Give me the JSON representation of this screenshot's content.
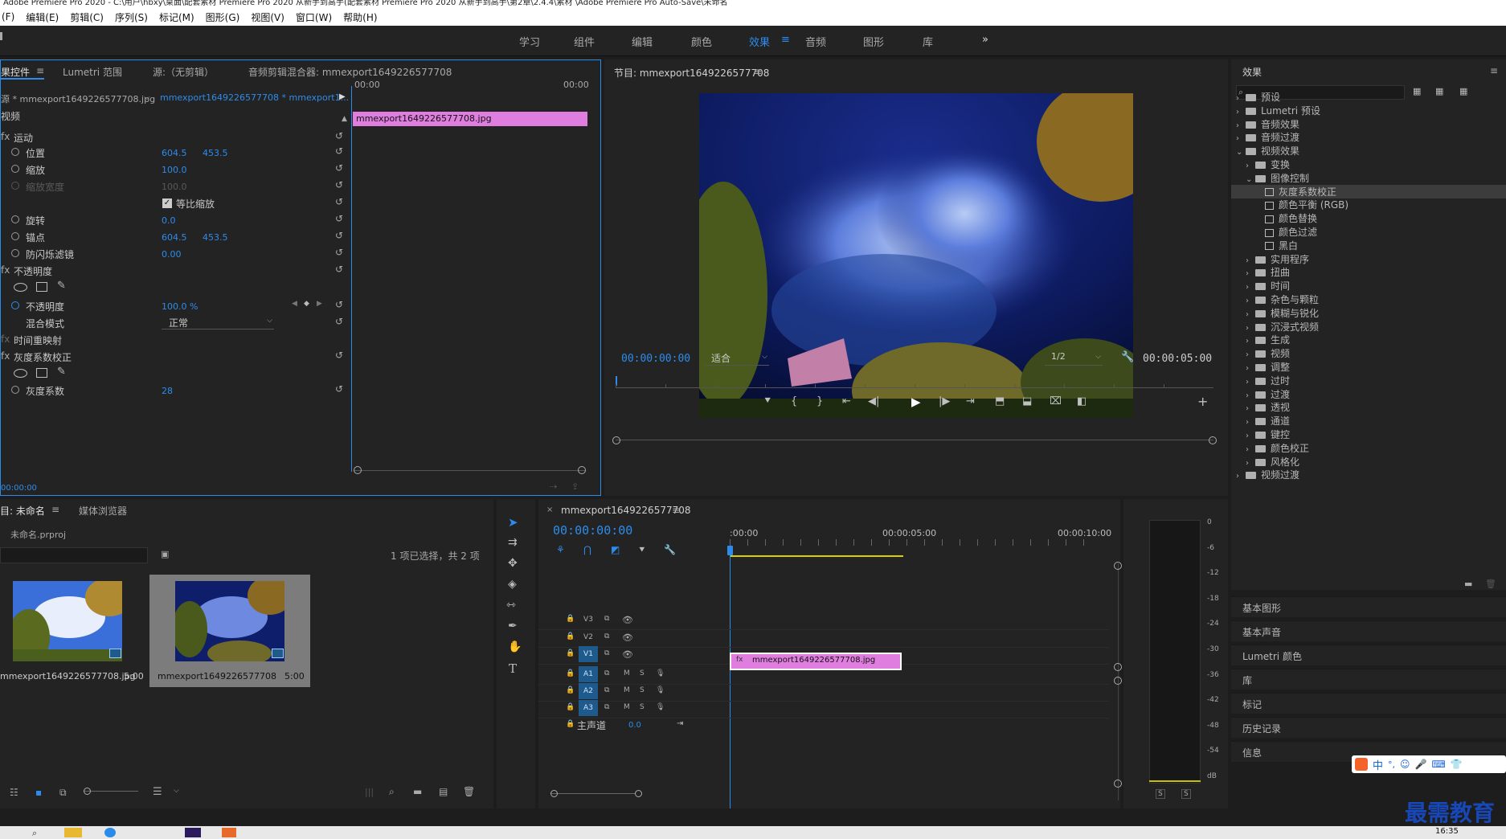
{
  "window": {
    "title": "Adobe Premiere Pro 2020 - C:\\用户\\hbxy\\桌面\\配套素材 Premiere Pro 2020 从新手到高手(配套素材 Premiere Pro 2020 从新手到高手\\第2章\\2.4.4\\素材 \\Adobe Premiere Pro Auto-Save\\未命名"
  },
  "menu": [
    "(F)",
    "编辑(E)",
    "剪辑(C)",
    "序列(S)",
    "标记(M)",
    "图形(G)",
    "视图(V)",
    "窗口(W)",
    "帮助(H)"
  ],
  "workspaces": [
    "学习",
    "组件",
    "编辑",
    "颜色",
    "效果",
    "音频",
    "图形",
    "库",
    "»"
  ],
  "active_workspace": "效果",
  "effect_controls": {
    "tabs": [
      "效果控件",
      "Lumetri 范围",
      "源:（无剪辑）",
      "音频剪辑混合器: mmexport1649226577708"
    ],
    "tabs_short": [
      "果控件",
      "Lumetri 范围",
      "源:（无剪辑）",
      "音频剪辑混合器: mmexport1649226577708"
    ],
    "source": "源 * mmexport1649226577708.jpg",
    "sequence": "mmexport1649226577708 * mmexport1...",
    "video_label": "视频",
    "ruler_start": "00:00",
    "ruler_end": "00:00",
    "clip_name": "mmexport1649226577708.jpg",
    "motion": "运动",
    "position": "位置",
    "position_x": "604.5",
    "position_y": "453.5",
    "scale": "缩放",
    "scale_val": "100.0",
    "scale_width": "缩放宽度",
    "scale_width_val": "100.0",
    "uniform_scale": "等比缩放",
    "rotation": "旋转",
    "rotation_val": "0.0",
    "anchor": "锚点",
    "anchor_x": "604.5",
    "anchor_y": "453.5",
    "antiflicker": "防闪烁滤镜",
    "antiflicker_val": "0.00",
    "opacity_group": "不透明度",
    "opacity": "不透明度",
    "opacity_val": "100.0 %",
    "blend": "混合模式",
    "blend_val": "正常",
    "time_remap": "时间重映射",
    "gamma_group": "灰度系数校正",
    "gamma": "灰度系数",
    "gamma_val": "28",
    "bottom_time": "00:00:00"
  },
  "program": {
    "title": "节目: mmexport1649226577708",
    "timecode": "00:00:00:00",
    "fit": "适合",
    "quality": "1/2",
    "duration": "00:00:05:00"
  },
  "project": {
    "tabs": [
      "项目: 未命名",
      "媒体浏览器"
    ],
    "tab_short": "目: 未命名",
    "file": "未命名.prproj",
    "selection": "1 项已选择，共 2 项",
    "items": [
      {
        "name": "mmexport1649226577708.jpg",
        "dur": "5:00"
      },
      {
        "name": "mmexport1649226577708",
        "dur": "5:00"
      }
    ]
  },
  "timeline": {
    "title": "mmexport1649226577708",
    "timecode": "00:00:00:00",
    "ruler": [
      ":00:00",
      "00:00:05:00",
      "00:00:10:00"
    ],
    "video_tracks": [
      "V3",
      "V2",
      "V1"
    ],
    "audio_tracks": [
      "A1",
      "A2",
      "A3"
    ],
    "master": "主声道",
    "master_val": "0.0",
    "clip": "mmexport1649226577708.jpg",
    "mute": "M",
    "solo": "S"
  },
  "meter": {
    "labels": [
      "0",
      "-6",
      "-12",
      "-18",
      "-24",
      "-30",
      "-36",
      "-42",
      "-48",
      "-54",
      "dB"
    ],
    "solo": [
      "S",
      "S"
    ]
  },
  "effects": {
    "title": "效果",
    "items": [
      {
        "label": "预设",
        "level": 0,
        "type": "folder",
        "open": false
      },
      {
        "label": "Lumetri 预设",
        "level": 0,
        "type": "folder",
        "open": false
      },
      {
        "label": "音频效果",
        "level": 0,
        "type": "folder",
        "open": false
      },
      {
        "label": "音频过渡",
        "level": 0,
        "type": "folder",
        "open": false
      },
      {
        "label": "视频效果",
        "level": 0,
        "type": "folder",
        "open": true
      },
      {
        "label": "变换",
        "level": 1,
        "type": "folder",
        "open": false
      },
      {
        "label": "图像控制",
        "level": 1,
        "type": "folder",
        "open": true
      },
      {
        "label": "灰度系数校正",
        "level": 2,
        "type": "effect",
        "selected": true
      },
      {
        "label": "颜色平衡 (RGB)",
        "level": 2,
        "type": "effect"
      },
      {
        "label": "颜色替换",
        "level": 2,
        "type": "effect"
      },
      {
        "label": "颜色过滤",
        "level": 2,
        "type": "effect"
      },
      {
        "label": "黑白",
        "level": 2,
        "type": "effect"
      },
      {
        "label": "实用程序",
        "level": 1,
        "type": "folder",
        "open": false
      },
      {
        "label": "扭曲",
        "level": 1,
        "type": "folder",
        "open": false
      },
      {
        "label": "时间",
        "level": 1,
        "type": "folder",
        "open": false
      },
      {
        "label": "杂色与颗粒",
        "level": 1,
        "type": "folder",
        "open": false
      },
      {
        "label": "模糊与锐化",
        "level": 1,
        "type": "folder",
        "open": false
      },
      {
        "label": "沉浸式视频",
        "level": 1,
        "type": "folder",
        "open": false
      },
      {
        "label": "生成",
        "level": 1,
        "type": "folder",
        "open": false
      },
      {
        "label": "视频",
        "level": 1,
        "type": "folder",
        "open": false
      },
      {
        "label": "调整",
        "level": 1,
        "type": "folder",
        "open": false
      },
      {
        "label": "过时",
        "level": 1,
        "type": "folder",
        "open": false
      },
      {
        "label": "过渡",
        "level": 1,
        "type": "folder",
        "open": false
      },
      {
        "label": "透视",
        "level": 1,
        "type": "folder",
        "open": false
      },
      {
        "label": "通道",
        "level": 1,
        "type": "folder",
        "open": false
      },
      {
        "label": "键控",
        "level": 1,
        "type": "folder",
        "open": false
      },
      {
        "label": "颜色校正",
        "level": 1,
        "type": "folder",
        "open": false
      },
      {
        "label": "风格化",
        "level": 1,
        "type": "folder",
        "open": false
      },
      {
        "label": "视频过渡",
        "level": 0,
        "type": "folder",
        "open": false
      }
    ],
    "side_panels": [
      "基本图形",
      "基本声音",
      "Lumetri 颜色",
      "库",
      "标记",
      "历史记录",
      "信息"
    ]
  },
  "ime": "中",
  "watermark": "最需教育",
  "clock": "16:35",
  "colors": {
    "accent": "#2d8ceb",
    "clip": "#e07ee0",
    "track_active": "#1f5a8c"
  }
}
